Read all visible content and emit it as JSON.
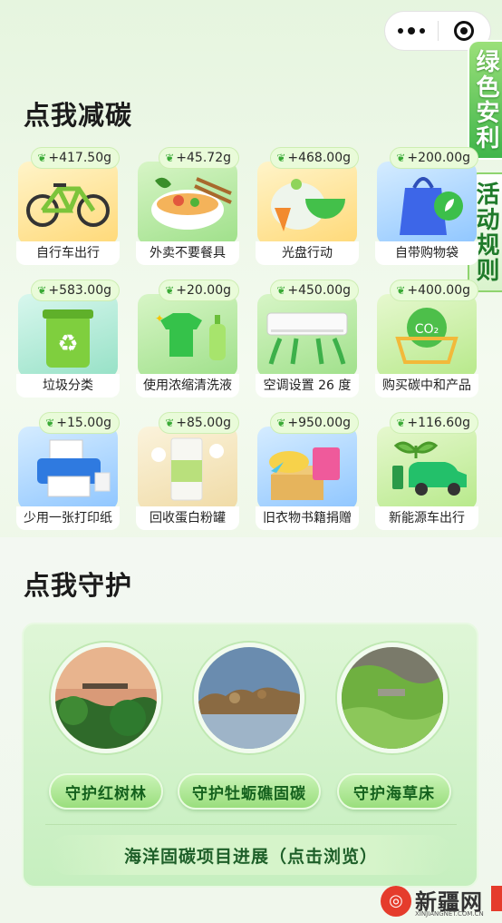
{
  "side_tabs": {
    "green_safety": "绿色安利",
    "rules": "活动规则"
  },
  "sections": {
    "reduce": "点我减碳",
    "protect": "点我守护"
  },
  "cards": [
    {
      "badge": "+417.50g",
      "label": "自行车出行",
      "icon": "bicycle-icon",
      "tone": "c-yellow"
    },
    {
      "badge": "+45.72g",
      "label": "外卖不要餐具",
      "icon": "bowl-chopsticks-icon",
      "tone": "c-green"
    },
    {
      "badge": "+468.00g",
      "label": "光盘行动",
      "icon": "empty-bowl-icon",
      "tone": "c-yellow"
    },
    {
      "badge": "+200.00g",
      "label": "自带购物袋",
      "icon": "shopping-bag-icon",
      "tone": "c-blue"
    },
    {
      "badge": "+583.00g",
      "label": "垃圾分类",
      "icon": "recycle-bin-icon",
      "tone": "c-teal"
    },
    {
      "badge": "+20.00g",
      "label": "使用浓缩清洗液",
      "icon": "detergent-icon",
      "tone": "c-green"
    },
    {
      "badge": "+450.00g",
      "label": "空调设置 26 度",
      "icon": "air-conditioner-icon",
      "tone": "c-green"
    },
    {
      "badge": "+400.00g",
      "label": "购买碳中和产品",
      "icon": "co2-cart-icon",
      "tone": "c-lime"
    },
    {
      "badge": "+15.00g",
      "label": "少用一张打印纸",
      "icon": "printer-icon",
      "tone": "c-blue"
    },
    {
      "badge": "+85.00g",
      "label": "回收蛋白粉罐",
      "icon": "protein-can-icon",
      "tone": "c-cream"
    },
    {
      "badge": "+950.00g",
      "label": "旧衣物书籍捐赠",
      "icon": "donation-box-icon",
      "tone": "c-blue"
    },
    {
      "badge": "+116.60g",
      "label": "新能源车出行",
      "icon": "electric-car-icon",
      "tone": "c-lime"
    }
  ],
  "protect": {
    "items": [
      {
        "label": "守护红树林",
        "image": "mangrove-photo"
      },
      {
        "label": "守护牡蛎礁固碳",
        "image": "oyster-reef-photo"
      },
      {
        "label": "守护海草床",
        "image": "seagrass-photo"
      }
    ],
    "progress_label": "海洋固碳项目进展（点击浏览）"
  },
  "watermark": {
    "logo_text": "新疆网",
    "url": "XINJIANGNET.COM.CN"
  },
  "colors": {
    "accent": "#3fb54a",
    "badge_bg": "#e9fbd9",
    "pill": "#9ade7d"
  }
}
